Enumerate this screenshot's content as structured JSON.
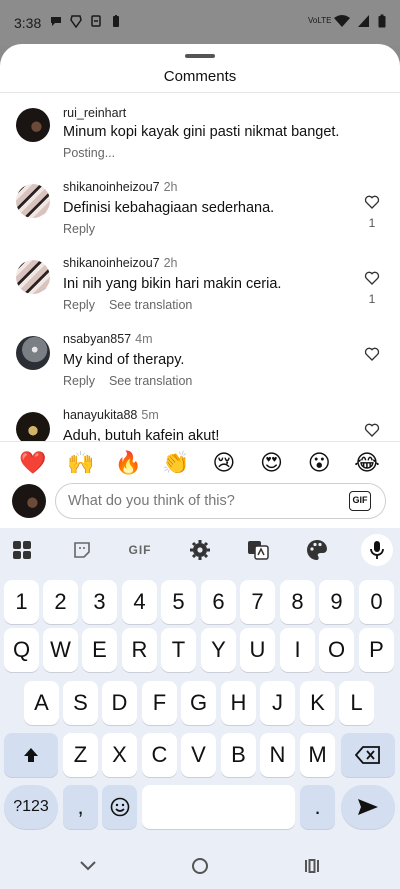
{
  "status_bar": {
    "time": "3:38",
    "left_icons": [
      "chat-bubble-icon",
      "brave-browser-icon",
      "sync-icon",
      "battery-saver-icon"
    ],
    "right_icons": [
      "volte-icon",
      "wifi-icon",
      "cell-signal-icon",
      "battery-icon"
    ],
    "volte_text": "VoLTE"
  },
  "sheet": {
    "title": "Comments"
  },
  "comments": [
    {
      "user": "rui_reinhart",
      "time": "",
      "text": "Minum kopi kayak gini pasti nikmat banget.",
      "status": "Posting...",
      "reply": "",
      "translate": "",
      "likes": "",
      "avatar": "av-dark",
      "show_heart": false
    },
    {
      "user": "shikanoinheizou7",
      "time": "2h",
      "text": "Definisi kebahagiaan sederhana.",
      "status": "",
      "reply": "Reply",
      "translate": "",
      "likes": "1",
      "avatar": "av-stripe",
      "show_heart": true
    },
    {
      "user": "shikanoinheizou7",
      "time": "2h",
      "text": "Ini nih yang bikin hari makin ceria.",
      "status": "",
      "reply": "Reply",
      "translate": "See translation",
      "likes": "1",
      "avatar": "av-stripe",
      "show_heart": true
    },
    {
      "user": "nsabyan857",
      "time": "4m",
      "text": "My kind of therapy.",
      "status": "",
      "reply": "Reply",
      "translate": "See translation",
      "likes": "",
      "avatar": "av-lamp",
      "show_heart": true
    },
    {
      "user": "hanayukita88",
      "time": "5m",
      "text": "Aduh, butuh kafein akut!",
      "status": "",
      "reply": "",
      "translate": "",
      "likes": "",
      "avatar": "av-cup",
      "show_heart": true
    }
  ],
  "emoji_bar": [
    "❤️",
    "🙌",
    "🔥",
    "👏",
    "😢",
    "😍",
    "😮",
    "😂"
  ],
  "comment_input": {
    "placeholder": "What do you think of this?",
    "value": "",
    "gif_label": "GIF"
  },
  "keyboard": {
    "toolbar": {
      "apps_icon": "apps-grid-icon",
      "sticker_icon": "sticker-icon",
      "gif_label": "GIF",
      "settings_icon": "gear-icon",
      "translate_icon": "translate-icon",
      "theme_icon": "palette-icon",
      "mic_icon": "mic-icon"
    },
    "row_numbers": [
      "1",
      "2",
      "3",
      "4",
      "5",
      "6",
      "7",
      "8",
      "9",
      "0"
    ],
    "row_1": [
      "Q",
      "W",
      "E",
      "R",
      "T",
      "Y",
      "U",
      "I",
      "O",
      "P"
    ],
    "row_2": [
      "A",
      "S",
      "D",
      "F",
      "G",
      "H",
      "J",
      "K",
      "L"
    ],
    "row_3": [
      "Z",
      "X",
      "C",
      "V",
      "B",
      "N",
      "M"
    ],
    "symbols_label": "?123",
    "comma_label": ",",
    "period_label": "."
  },
  "nav_bar": {
    "icons": [
      "back-chevron-icon",
      "home-circle-icon",
      "recents-icon"
    ]
  },
  "colors": {
    "accent": "#d3dff0",
    "keyboard_bg": "#e9eef7",
    "heart_red": "#e0245e"
  }
}
